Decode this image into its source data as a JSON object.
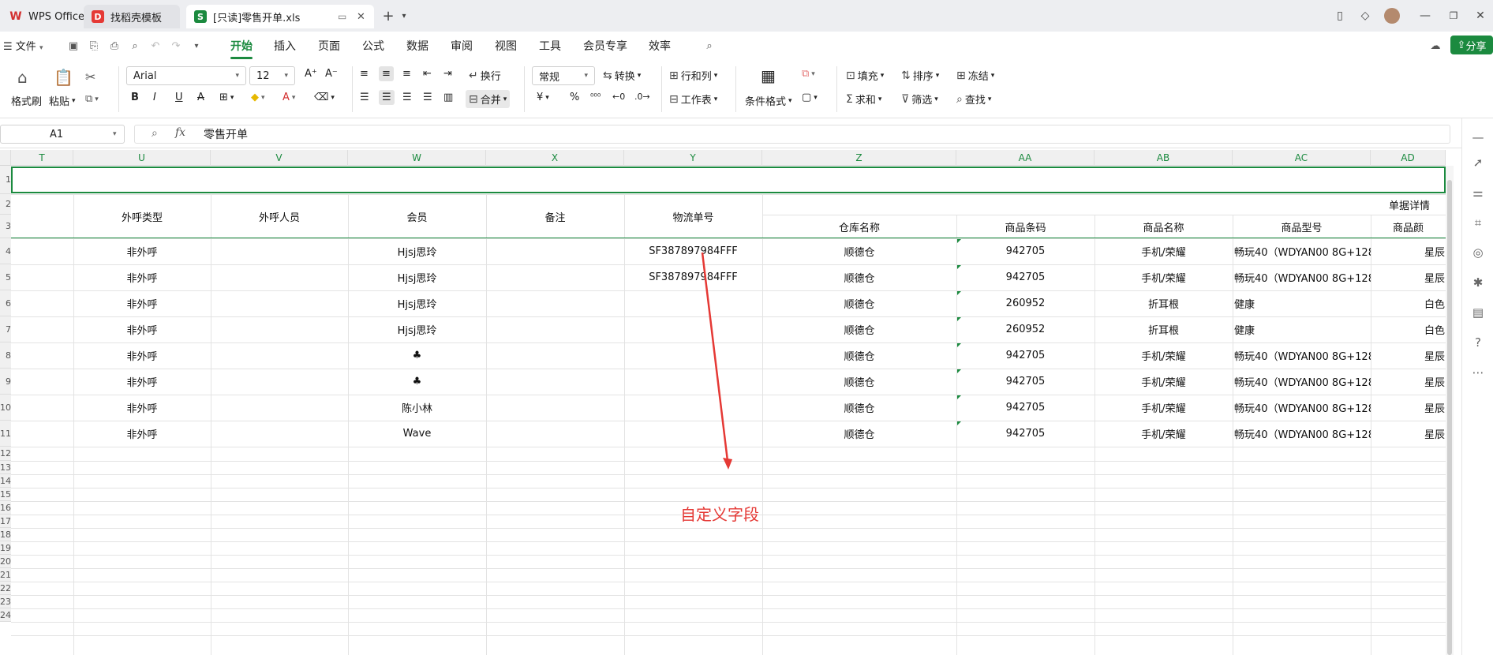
{
  "tabs": [
    {
      "label": "WPS Office"
    },
    {
      "label": "找稻壳模板"
    },
    {
      "label": "[只读]零售开单.xls"
    }
  ],
  "menu": {
    "file": "文件",
    "items": [
      "开始",
      "插入",
      "页面",
      "公式",
      "数据",
      "审阅",
      "视图",
      "工具",
      "会员专享",
      "效率"
    ],
    "share": "分享"
  },
  "ribbon": {
    "format_painter": "格式刷",
    "paste": "粘贴",
    "font_name": "Arial",
    "font_size": "12",
    "wrap": "换行",
    "merge": "合并",
    "number_format": "常规",
    "convert": "转换",
    "row_col": "行和列",
    "worksheet": "工作表",
    "cond_format": "条件格式",
    "fill": "填充",
    "sort": "排序",
    "freeze": "冻结",
    "sum": "求和",
    "filter": "筛选",
    "find": "查找"
  },
  "formula_bar": {
    "cell_ref": "A1",
    "content": "零售开单",
    "fx": "fx"
  },
  "columns": [
    "T",
    "U",
    "V",
    "W",
    "X",
    "Y",
    "Z",
    "AA",
    "AB",
    "AC",
    "AD"
  ],
  "row_numbers": [
    "1",
    "2",
    "3",
    "4",
    "5",
    "6",
    "7",
    "8",
    "9",
    "10",
    "11",
    "12",
    "13",
    "14",
    "15",
    "16",
    "17",
    "18",
    "19",
    "20",
    "21",
    "22",
    "23",
    "24"
  ],
  "header_row": {
    "U": "外呼类型",
    "V": "外呼人员",
    "W": "会员",
    "X": "备注",
    "Y": "物流单号",
    "group": "单据详情",
    "Z": "仓库名称",
    "AA": "商品条码",
    "AB": "商品名称",
    "AC": "商品型号",
    "AD": "商品颜"
  },
  "rows": [
    {
      "U": "非外呼",
      "W": "Hjsj思玲",
      "Y": "SF387897984FFF",
      "Z": "顺德仓",
      "AA": "942705",
      "AB": "手机/荣耀",
      "AC": "畅玩40（WDYAN00 8G+128",
      "AD": "星辰"
    },
    {
      "U": "非外呼",
      "W": "Hjsj思玲",
      "Y": "SF387897984FFF",
      "Z": "顺德仓",
      "AA": "942705",
      "AB": "手机/荣耀",
      "AC": "畅玩40（WDYAN00 8G+128",
      "AD": "星辰"
    },
    {
      "U": "非外呼",
      "W": "Hjsj思玲",
      "Y": "",
      "Z": "顺德仓",
      "AA": "260952",
      "AB": "折耳根",
      "AC": "健康",
      "AD": "白色"
    },
    {
      "U": "非外呼",
      "W": "Hjsj思玲",
      "Y": "",
      "Z": "顺德仓",
      "AA": "260952",
      "AB": "折耳根",
      "AC": "健康",
      "AD": "白色"
    },
    {
      "U": "非外呼",
      "W": "♣",
      "Y": "",
      "Z": "顺德仓",
      "AA": "942705",
      "AB": "手机/荣耀",
      "AC": "畅玩40（WDYAN00 8G+128",
      "AD": "星辰"
    },
    {
      "U": "非外呼",
      "W": "♣",
      "Y": "",
      "Z": "顺德仓",
      "AA": "942705",
      "AB": "手机/荣耀",
      "AC": "畅玩40（WDYAN00 8G+128",
      "AD": "星辰"
    },
    {
      "U": "非外呼",
      "W": "陈小林",
      "Y": "",
      "Z": "顺德仓",
      "AA": "942705",
      "AB": "手机/荣耀",
      "AC": "畅玩40（WDYAN00 8G+128",
      "AD": "星辰"
    },
    {
      "U": "非外呼",
      "W": "Wave",
      "Y": "",
      "Z": "顺德仓",
      "AA": "942705",
      "AB": "手机/荣耀",
      "AC": "畅玩40（WDYAN00 8G+128",
      "AD": "星辰"
    }
  ],
  "annotation": "自定义字段",
  "colors": {
    "accent": "#1b8a3f",
    "annotation": "#e53935"
  }
}
